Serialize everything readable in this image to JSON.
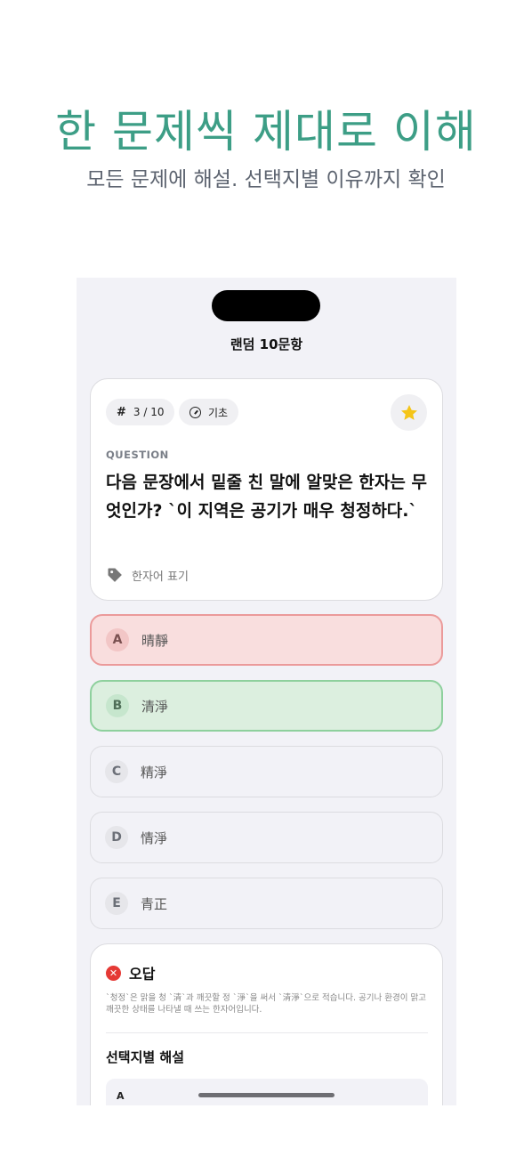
{
  "promo": {
    "headline": "한 문제씩 제대로 이해",
    "subline": "모든 문제에 해설. 선택지별 이유까지 확인"
  },
  "nav": {
    "title": "랜덤 10문항"
  },
  "question": {
    "counter": "3 / 10",
    "level": "기초",
    "label": "QUESTION",
    "text": "다음 문장에서 밑줄 친 말에 알맞은 한자는 무엇인가? `이 지역은 공기가 매우 청정하다.`",
    "tag": "한자어 표기",
    "icons": {
      "counter": "hash-icon",
      "level": "gauge-icon",
      "favorite": "star-icon",
      "tag": "tag-icon"
    },
    "colors": {
      "star": "#f5c518"
    }
  },
  "options": [
    {
      "letter": "A",
      "text": "晴靜",
      "state": "wrong"
    },
    {
      "letter": "B",
      "text": "清淨",
      "state": "correct"
    },
    {
      "letter": "C",
      "text": "精淨",
      "state": "neutral"
    },
    {
      "letter": "D",
      "text": "情淨",
      "state": "neutral"
    },
    {
      "letter": "E",
      "text": "青正",
      "state": "neutral"
    }
  ],
  "answer": {
    "result": "오답",
    "explanation": "`청정`은 맑을 청 `清`과 깨끗할 정 `淨`을 써서 `清淨`으로 적습니다. 공기나 환경이 맑고 깨끗한 상태를 나타낼 때 쓰는 한자어입니다.",
    "section_title": "선택지별 해설",
    "first_row_letter": "A",
    "colors": {
      "wrong": "#e53935",
      "correct": "#8ed09d"
    }
  }
}
